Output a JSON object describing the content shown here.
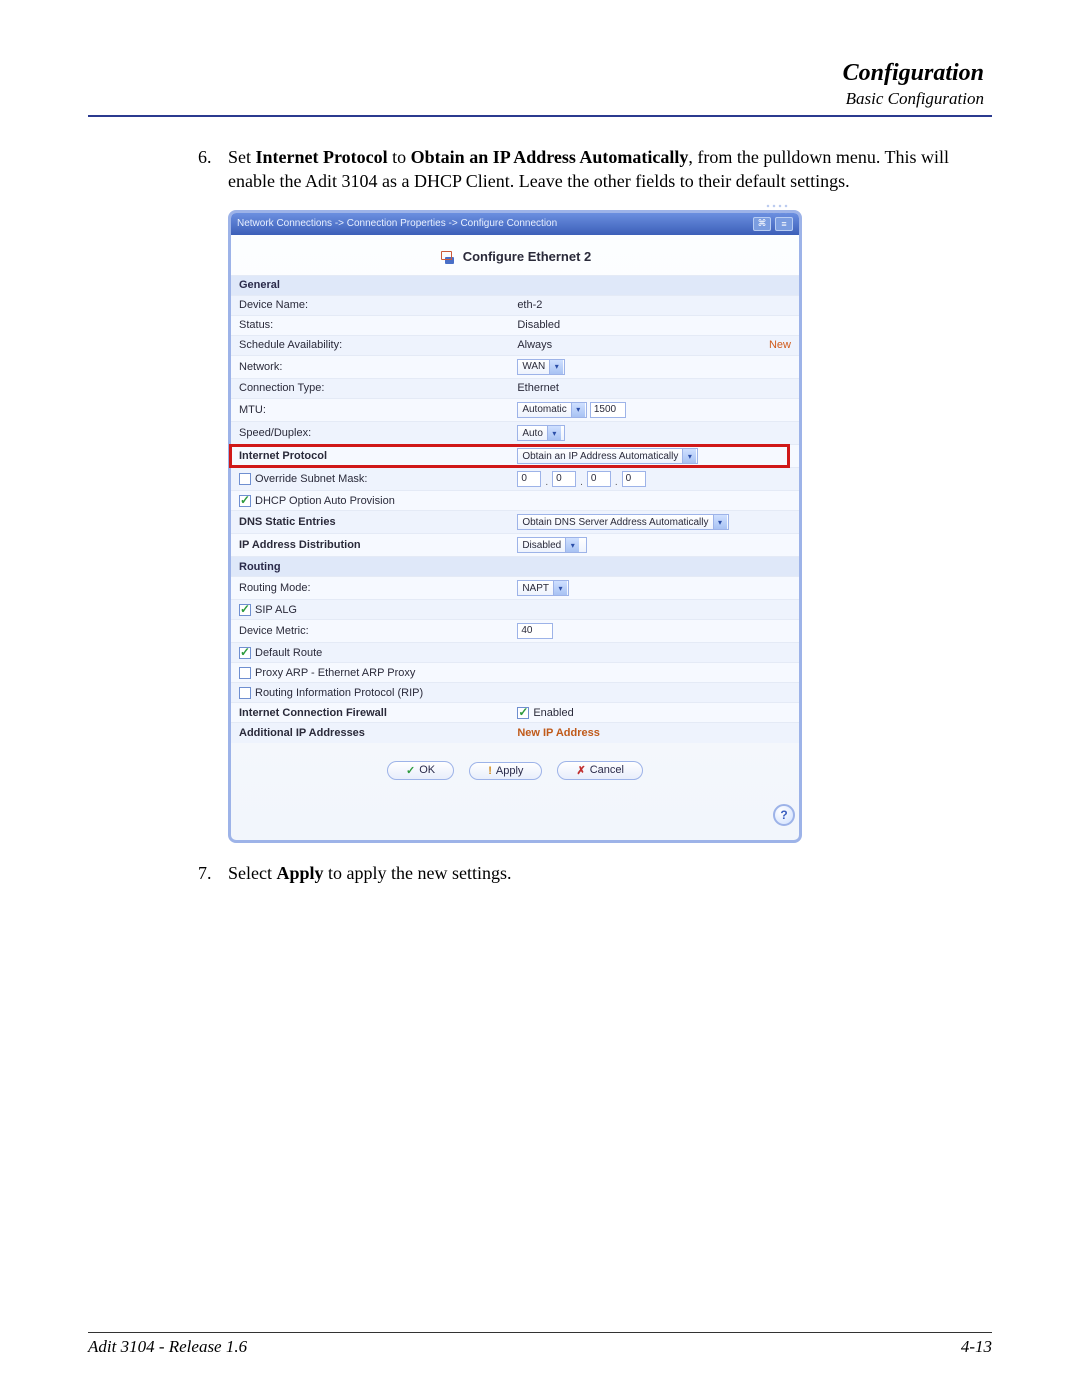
{
  "header": {
    "title": "Configuration",
    "subtitle": "Basic Configuration"
  },
  "instructions": {
    "step6_num": "6.",
    "step6_a": "Set ",
    "step6_b": "Internet Protocol",
    "step6_c": " to ",
    "step6_d": "Obtain an IP Address Automatically",
    "step6_e": ", from the pulldown menu. This will enable the Adit 3104 as a DHCP Client. Leave the other fields to their default settings.",
    "step7_num": "7.",
    "step7_a": "Select ",
    "step7_b": "Apply",
    "step7_c": " to apply the new settings."
  },
  "router": {
    "breadcrumb": "Network Connections -> Connection Properties -> Configure Connection",
    "panel_title": "Configure Ethernet 2",
    "sections": {
      "general": "General",
      "routing": "Routing"
    },
    "rows": {
      "device_name": {
        "label": "Device Name:",
        "value": "eth-2"
      },
      "status": {
        "label": "Status:",
        "value": "Disabled"
      },
      "schedule": {
        "label": "Schedule Availability:",
        "value": "Always",
        "action": "New"
      },
      "network": {
        "label": "Network:",
        "value": "WAN"
      },
      "conn_type": {
        "label": "Connection Type:",
        "value": "Ethernet"
      },
      "mtu": {
        "label": "MTU:",
        "mode": "Automatic",
        "value": "1500"
      },
      "speed": {
        "label": "Speed/Duplex:",
        "value": "Auto"
      },
      "ip_proto": {
        "label": "Internet Protocol",
        "value": "Obtain an IP Address Automatically"
      },
      "override_mask": {
        "label": "Override Subnet Mask:",
        "o1": "0",
        "o2": "0",
        "o3": "0",
        "o4": "0"
      },
      "dhcp_auto": {
        "label": "DHCP Option Auto Provision"
      },
      "dns_static": {
        "label": "DNS Static Entries",
        "value": "Obtain DNS Server Address Automatically"
      },
      "ip_dist": {
        "label": "IP Address Distribution",
        "value": "Disabled"
      },
      "routing_mode": {
        "label": "Routing Mode:",
        "value": "NAPT"
      },
      "sip_alg": {
        "label": "SIP ALG"
      },
      "device_metric": {
        "label": "Device Metric:",
        "value": "40"
      },
      "default_route": {
        "label": "Default Route"
      },
      "proxy_arp": {
        "label": "Proxy ARP - Ethernet ARP Proxy"
      },
      "rip": {
        "label": "Routing Information Protocol (RIP)"
      },
      "firewall": {
        "label": "Internet Connection Firewall",
        "value": "Enabled"
      },
      "add_ip": {
        "label": "Additional IP Addresses",
        "value": "New IP Address"
      }
    },
    "buttons": {
      "ok": "OK",
      "apply": "Apply",
      "cancel": "Cancel"
    },
    "help": "?"
  },
  "footer": {
    "left": "Adit 3104 - Release 1.6",
    "right": "4-13"
  }
}
